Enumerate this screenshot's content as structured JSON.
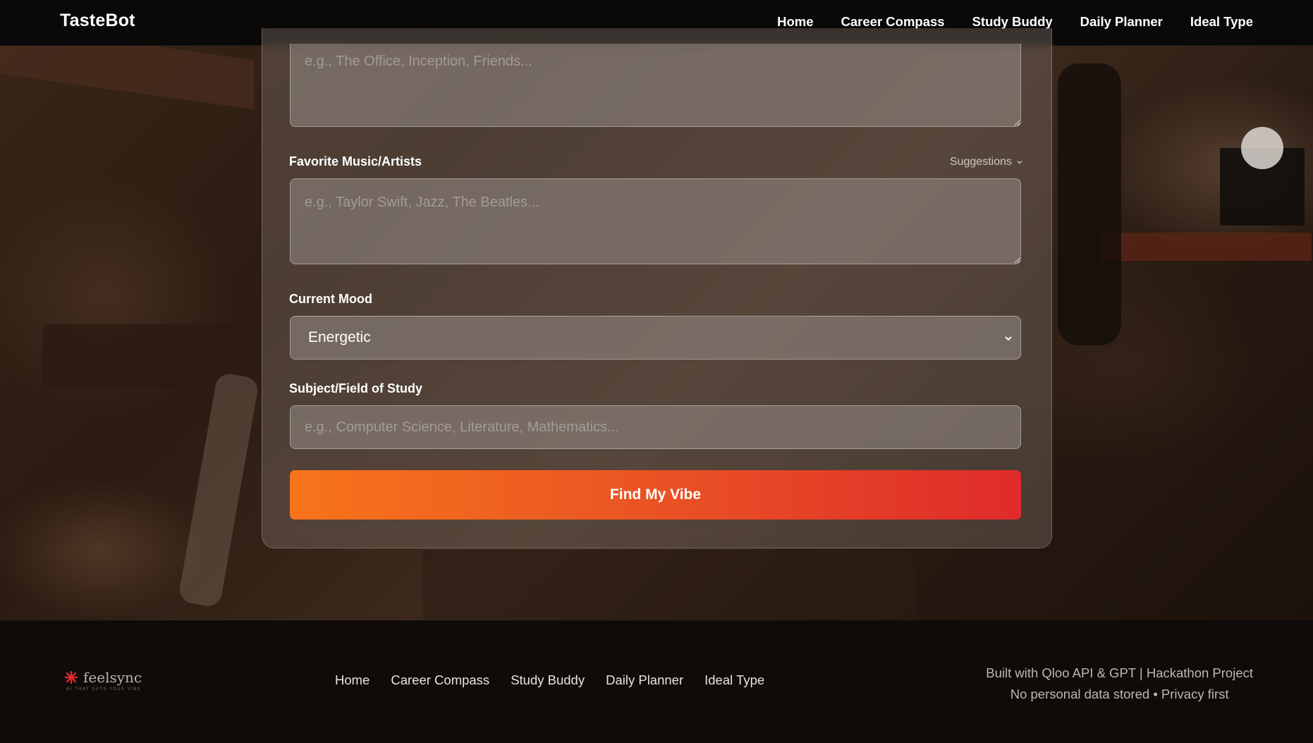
{
  "navbar": {
    "brand": "TasteBot",
    "links": [
      "Home",
      "Career Compass",
      "Study Buddy",
      "Daily Planner",
      "Ideal Type"
    ]
  },
  "form": {
    "tv_shows": {
      "placeholder": "e.g., The Office, Inception, Friends..."
    },
    "music": {
      "label": "Favorite Music/Artists",
      "suggestions_label": "Suggestions",
      "placeholder": "e.g., Taylor Swift, Jazz, The Beatles..."
    },
    "mood": {
      "label": "Current Mood",
      "selected": "Energetic"
    },
    "subject": {
      "label": "Subject/Field of Study",
      "placeholder": "e.g., Computer Science, Literature, Mathematics..."
    },
    "submit_label": "Find My Vibe"
  },
  "footer": {
    "logo_text": "feelsync",
    "logo_tagline": "AI THAT GETS YOUR VIBE",
    "links": [
      "Home",
      "Career Compass",
      "Study Buddy",
      "Daily Planner",
      "Ideal Type"
    ],
    "credit_line": "Built with Qloo API & GPT | Hackathon Project",
    "privacy_line": "No personal data stored • Privacy first"
  },
  "colors": {
    "accent_start": "#f8741b",
    "accent_end": "#df2b2b",
    "logo_mark": "#e0262b"
  }
}
